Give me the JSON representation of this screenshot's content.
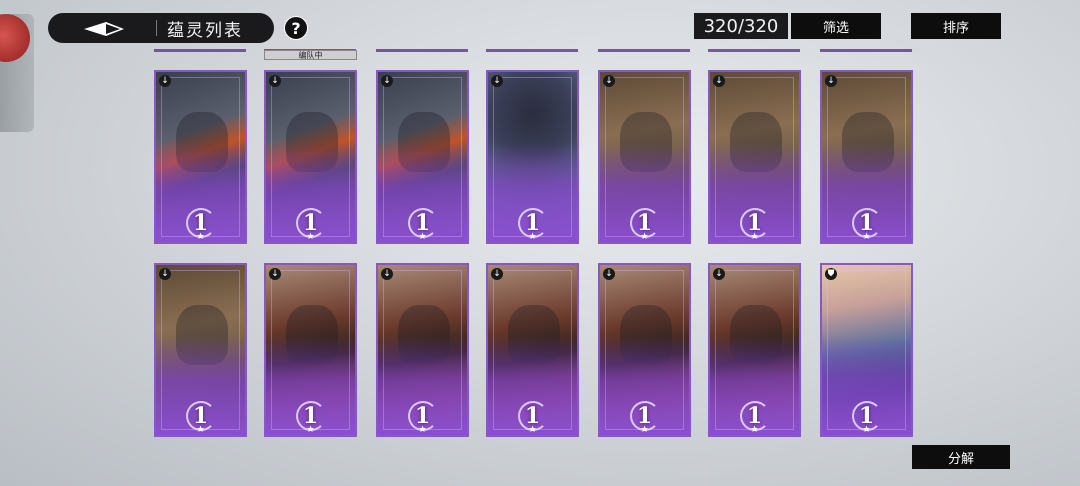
{
  "header": {
    "title": "蕴灵列表",
    "help_icon": "question-mark-icon",
    "back_icon": "diamond-arrow-icon",
    "count": "320/320",
    "filter_label": "筛选",
    "sort_label": "排序"
  },
  "team_tag": "编队中",
  "footer": {
    "decompose_label": "分解"
  },
  "cards": [
    {
      "level": "1",
      "star": "★",
      "art": "orange-haired-knight",
      "lock_icon": "lock-icon"
    },
    {
      "level": "1",
      "star": "★",
      "art": "orange-haired-knight",
      "lock_icon": "lock-icon"
    },
    {
      "level": "1",
      "star": "★",
      "art": "orange-haired-knight",
      "lock_icon": "lock-icon"
    },
    {
      "level": "1",
      "star": "★",
      "art": "dark-hooded-assassin",
      "lock_icon": "lock-icon"
    },
    {
      "level": "1",
      "star": "★",
      "art": "spiked-armored-brute",
      "lock_icon": "lock-icon"
    },
    {
      "level": "1",
      "star": "★",
      "art": "spiked-armored-brute",
      "lock_icon": "lock-icon"
    },
    {
      "level": "1",
      "star": "★",
      "art": "spiked-armored-brute",
      "lock_icon": "lock-icon"
    },
    {
      "level": "1",
      "star": "★",
      "art": "spiked-armored-brute",
      "lock_icon": "lock-icon"
    },
    {
      "level": "1",
      "star": "★",
      "art": "red-crested-warrior",
      "lock_icon": "lock-icon"
    },
    {
      "level": "1",
      "star": "★",
      "art": "red-crested-warrior",
      "lock_icon": "lock-icon"
    },
    {
      "level": "1",
      "star": "★",
      "art": "red-crested-warrior",
      "lock_icon": "lock-icon"
    },
    {
      "level": "1",
      "star": "★",
      "art": "red-crested-warrior",
      "lock_icon": "lock-icon"
    },
    {
      "level": "1",
      "star": "★",
      "art": "red-crested-warrior",
      "lock_icon": "lock-icon"
    },
    {
      "level": "1",
      "star": "★",
      "art": "blue-dress-girl",
      "lock_icon": "shield-icon"
    }
  ],
  "colors": {
    "card_border": "#8a55c6",
    "card_bottom": "#8a4fcf",
    "button_bg": "#0d0d0e"
  }
}
